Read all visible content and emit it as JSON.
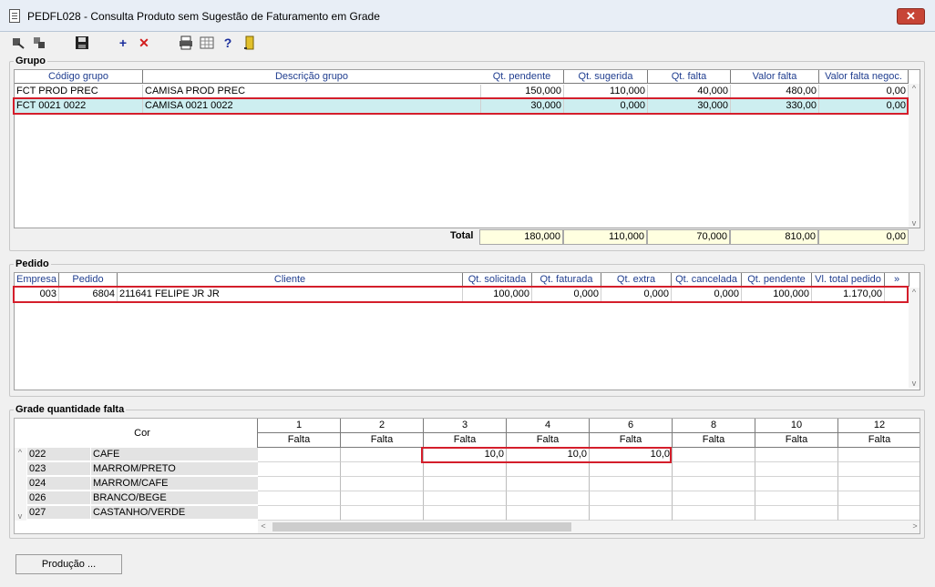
{
  "window": {
    "title": "PEDFL028 - Consulta Produto sem Sugestão de Faturamento em Grade",
    "close_label": "✕"
  },
  "toolbar": {
    "items": [
      "filter-icon",
      "filter-clear-icon",
      "save-icon",
      "add-icon",
      "delete-icon",
      "print-icon",
      "grid-icon",
      "help-icon",
      "exit-icon"
    ]
  },
  "grupo": {
    "legend": "Grupo",
    "headers": [
      "Código grupo",
      "Descrição grupo",
      "Qt. pendente",
      "Qt. sugerida",
      "Qt. falta",
      "Valor falta",
      "Valor falta negoc."
    ],
    "rows": [
      [
        "FCT PROD PREC",
        "CAMISA PROD PREC",
        "150,000",
        "110,000",
        "40,000",
        "480,00",
        "0,00"
      ],
      [
        "FCT 0021 0022",
        "CAMISA 0021 0022",
        "30,000",
        "0,000",
        "30,000",
        "330,00",
        "0,00"
      ]
    ],
    "total_label": "Total",
    "totals": [
      "180,000",
      "110,000",
      "70,000",
      "810,00",
      "0,00"
    ]
  },
  "pedido": {
    "legend": "Pedido",
    "headers": [
      "Empresa",
      "Pedido",
      "Cliente",
      "Qt. solicitada",
      "Qt. faturada",
      "Qt. extra",
      "Qt. cancelada",
      "Qt. pendente",
      "Vl. total pedido",
      "»"
    ],
    "rows": [
      [
        "003",
        "6804",
        "211641 FELIPE JR JR",
        "100,000",
        "0,000",
        "0,000",
        "0,000",
        "100,000",
        "1.170,00"
      ]
    ]
  },
  "grade": {
    "legend": "Grade quantidade falta",
    "cor_header": "Cor",
    "sizes": [
      "1",
      "2",
      "3",
      "4",
      "6",
      "8",
      "10",
      "12"
    ],
    "sub_header": "Falta",
    "rows": [
      {
        "code": "022",
        "name": "CAFE",
        "values": [
          "",
          "",
          "10,0",
          "10,0",
          "10,0",
          "",
          "",
          ""
        ]
      },
      {
        "code": "023",
        "name": "MARROM/PRETO",
        "values": [
          "",
          "",
          "",
          "",
          "",
          "",
          "",
          ""
        ]
      },
      {
        "code": "024",
        "name": "MARROM/CAFE",
        "values": [
          "",
          "",
          "",
          "",
          "",
          "",
          "",
          ""
        ]
      },
      {
        "code": "026",
        "name": "BRANCO/BEGE",
        "values": [
          "",
          "",
          "",
          "",
          "",
          "",
          "",
          ""
        ]
      },
      {
        "code": "027",
        "name": "CASTANHO/VERDE",
        "values": [
          "",
          "",
          "",
          "",
          "",
          "",
          "",
          ""
        ]
      }
    ]
  },
  "producao_button": "Produção ..."
}
